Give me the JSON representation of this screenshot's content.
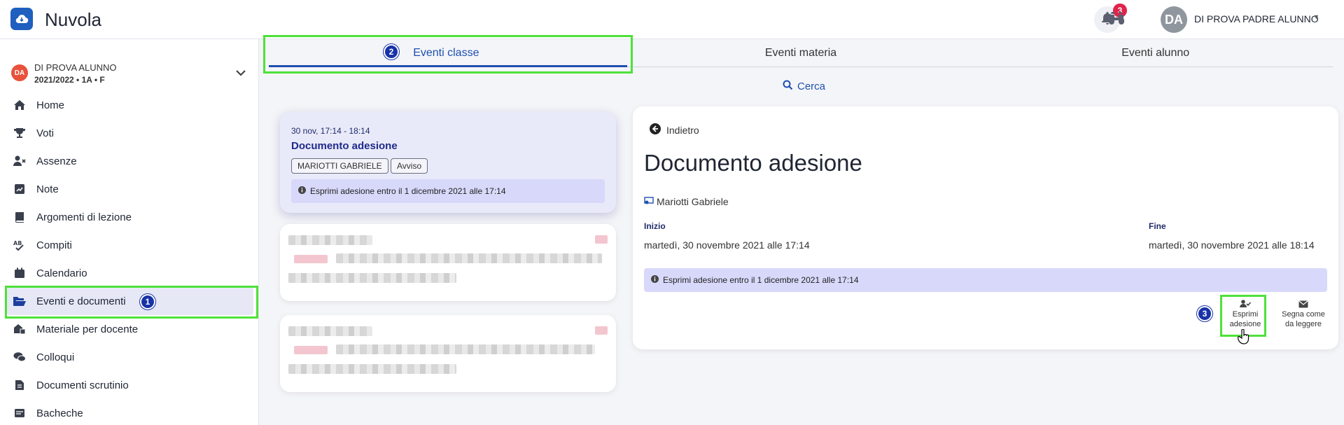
{
  "app": {
    "title": "Nuvola"
  },
  "header": {
    "notification_count": "3",
    "user_initials": "DA",
    "user_name": "DI PROVA PADRE ALUNNO"
  },
  "student": {
    "initials": "DA",
    "name": "DI PROVA ALUNNO",
    "class": "2021/2022 • 1A • F"
  },
  "sidebar": {
    "items": [
      {
        "label": "Home",
        "icon": "home-icon"
      },
      {
        "label": "Voti",
        "icon": "trophy-icon"
      },
      {
        "label": "Assenze",
        "icon": "user-x-icon"
      },
      {
        "label": "Note",
        "icon": "note-icon"
      },
      {
        "label": "Argomenti di lezione",
        "icon": "book-icon"
      },
      {
        "label": "Compiti",
        "icon": "spellcheck-icon"
      },
      {
        "label": "Calendario",
        "icon": "calendar-icon"
      },
      {
        "label": "Eventi e documenti",
        "icon": "folder-open-icon",
        "active": true
      },
      {
        "label": "Materiale per docente",
        "icon": "materials-icon"
      },
      {
        "label": "Colloqui",
        "icon": "chat-icon"
      },
      {
        "label": "Documenti scrutinio",
        "icon": "file-icon"
      },
      {
        "label": "Bacheche",
        "icon": "board-icon"
      }
    ]
  },
  "tabs": [
    {
      "label": "Eventi classe",
      "active": true
    },
    {
      "label": "Eventi materia"
    },
    {
      "label": "Eventi alunno"
    }
  ],
  "search": {
    "label": "Cerca"
  },
  "events": [
    {
      "time": "30 nov, 17:14 - 18:14",
      "title": "Documento adesione",
      "chips": [
        "MARIOTTI GABRIELE",
        "Avviso"
      ],
      "info": "Esprimi adesione entro il 1 dicembre 2021 alle 17:14"
    }
  ],
  "detail": {
    "back_label": "Indietro",
    "title": "Documento adesione",
    "teacher": "Mariotti Gabriele",
    "start_label": "Inizio",
    "start_value": "martedì, 30 novembre 2021 alle 17:14",
    "end_label": "Fine",
    "end_value": "martedì, 30 novembre 2021 alle 18:14",
    "info": "Esprimi adesione entro il 1 dicembre 2021 alle 17:14",
    "actions": [
      {
        "line1": "Esprimi",
        "line2": "adesione"
      },
      {
        "line1": "Segna come",
        "line2": "da leggere"
      }
    ]
  },
  "annotations": {
    "step1": "1",
    "step2": "2",
    "step3": "3"
  },
  "colors": {
    "accent": "#1e4fb0",
    "highlight": "#4ee13a",
    "badge": "#e0234a",
    "info_bg": "#d8d9fa"
  }
}
